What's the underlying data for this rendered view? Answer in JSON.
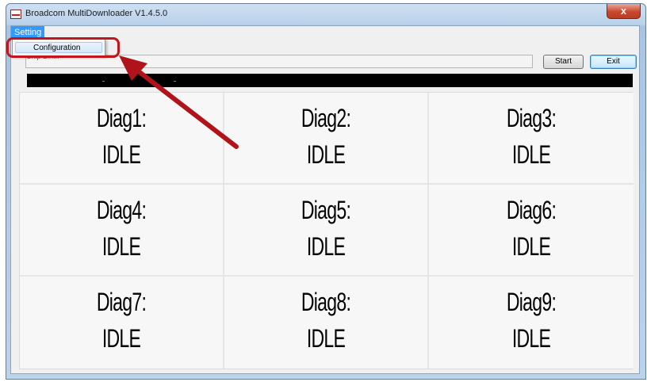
{
  "window": {
    "title": "Broadcom MultiDownloader V1.4.5.0",
    "close_label": "x"
  },
  "menu": {
    "setting_label": "Setting",
    "dropdown_items": [
      "Configuration"
    ]
  },
  "toolbar": {
    "bin_label": "Chip Bin...",
    "start_label": "Start",
    "exit_label": "Exit"
  },
  "diags": [
    {
      "name": "Diag1:",
      "state": "IDLE"
    },
    {
      "name": "Diag2:",
      "state": "IDLE"
    },
    {
      "name": "Diag3:",
      "state": "IDLE"
    },
    {
      "name": "Diag4:",
      "state": "IDLE"
    },
    {
      "name": "Diag5:",
      "state": "IDLE"
    },
    {
      "name": "Diag6:",
      "state": "IDLE"
    },
    {
      "name": "Diag7:",
      "state": "IDLE"
    },
    {
      "name": "Diag8:",
      "state": "IDLE"
    },
    {
      "name": "Diag9:",
      "state": "IDLE"
    }
  ],
  "colors": {
    "menu_highlight": "#3399ff",
    "annotation": "#c0161c",
    "progress_bg": "#000000"
  }
}
